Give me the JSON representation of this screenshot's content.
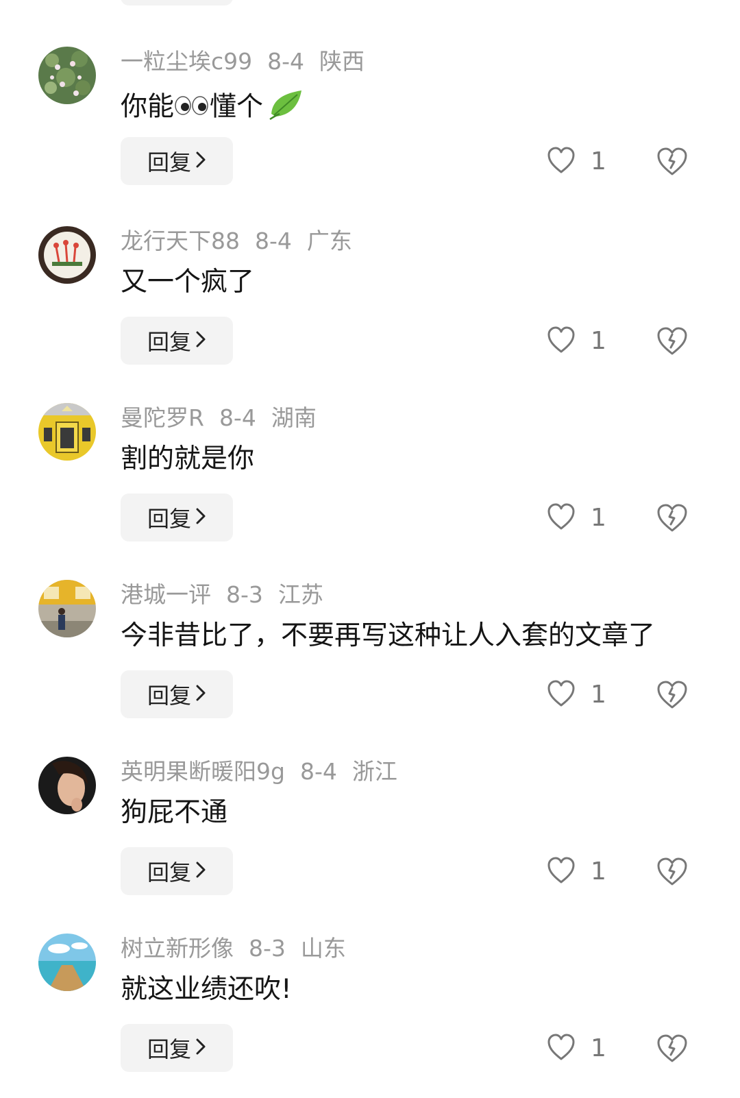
{
  "comments": [
    {
      "username": "一粒尘埃c99",
      "date": "8-4",
      "location": "陕西",
      "text": "你能",
      "text_after_emoji": "懂个",
      "emojis": [
        "eyes-emoji",
        "leaf-emoji"
      ],
      "reply_label": "回复",
      "likes": "1"
    },
    {
      "username": "龙行天下88",
      "date": "8-4",
      "location": "广东",
      "text": "又一个疯了",
      "reply_label": "回复",
      "likes": "1"
    },
    {
      "username": "曼陀罗R",
      "date": "8-4",
      "location": "湖南",
      "text": "割的就是你",
      "reply_label": "回复",
      "likes": "1"
    },
    {
      "username": "港城一评",
      "date": "8-3",
      "location": "江苏",
      "text": "今非昔比了，不要再写这种让人入套的文章了",
      "reply_label": "回复",
      "likes": "1"
    },
    {
      "username": "英明果断暖阳9g",
      "date": "8-4",
      "location": "浙江",
      "text": "狗屁不通",
      "reply_label": "回复",
      "likes": "1"
    },
    {
      "username": "树立新形像",
      "date": "8-3",
      "location": "山东",
      "text": "就这业绩还吹!",
      "reply_label": "回复",
      "likes": "1"
    }
  ],
  "colors": {
    "meta": "#999999",
    "text": "#151515",
    "button_bg": "#f3f3f3",
    "icon": "#777777"
  }
}
